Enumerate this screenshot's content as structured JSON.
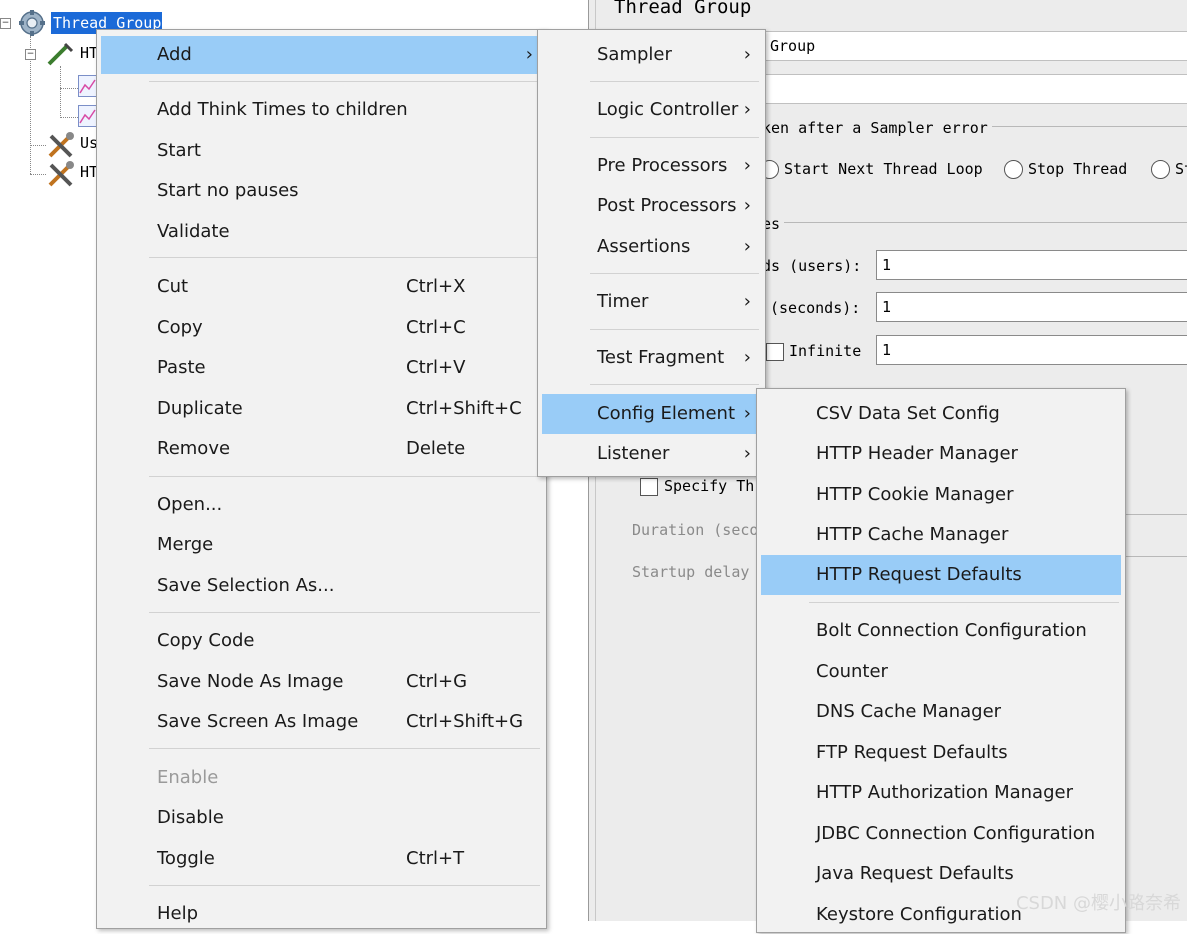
{
  "tree": {
    "selected": "Thread Group",
    "rows": [
      "HT",
      "Us",
      "HT"
    ]
  },
  "panel": {
    "title": "Thread Group",
    "name_value": "Group",
    "error_label": "ken after a Sampler error",
    "radio_next_loop": "Start Next Thread Loop",
    "radio_stop_thread": "Stop Thread",
    "radio_partial": "St",
    "props_partial": "es",
    "threads_label": "ds (users):",
    "threads_value": "1",
    "rampup_label": "(seconds):",
    "rampup_value": "1",
    "infinite_label": "Infinite",
    "loop_value": "1",
    "specify_label": "Specify Thr",
    "duration_label": "Duration (seco",
    "startup_label": "Startup delay"
  },
  "context_menu": {
    "add": "Add",
    "add_think_times": "Add Think Times to children",
    "start": "Start",
    "start_no_pauses": "Start no pauses",
    "validate": "Validate",
    "cut": "Cut",
    "cut_sc": "Ctrl+X",
    "copy": "Copy",
    "copy_sc": "Ctrl+C",
    "paste": "Paste",
    "paste_sc": "Ctrl+V",
    "duplicate": "Duplicate",
    "duplicate_sc": "Ctrl+Shift+C",
    "remove": "Remove",
    "remove_sc": "Delete",
    "open": "Open...",
    "merge": "Merge",
    "save_selection": "Save Selection As...",
    "copy_code": "Copy Code",
    "save_node_image": "Save Node As Image",
    "save_node_image_sc": "Ctrl+G",
    "save_screen_image": "Save Screen As Image",
    "save_screen_image_sc": "Ctrl+Shift+G",
    "enable": "Enable",
    "disable": "Disable",
    "toggle": "Toggle",
    "toggle_sc": "Ctrl+T",
    "help": "Help"
  },
  "add_menu": {
    "sampler": "Sampler",
    "logic_controller": "Logic Controller",
    "pre_processors": "Pre Processors",
    "post_processors": "Post Processors",
    "assertions": "Assertions",
    "timer": "Timer",
    "test_fragment": "Test Fragment",
    "config_element": "Config Element",
    "listener": "Listener"
  },
  "config_menu": {
    "csv_data_set": "CSV Data Set Config",
    "http_header_manager": "HTTP Header Manager",
    "http_cookie_manager": "HTTP Cookie Manager",
    "http_cache_manager": "HTTP Cache Manager",
    "http_request_defaults": "HTTP Request Defaults",
    "bolt_connection": "Bolt Connection Configuration",
    "counter": "Counter",
    "dns_cache_manager": "DNS Cache Manager",
    "ftp_request_defaults": "FTP Request Defaults",
    "http_auth_manager": "HTTP Authorization Manager",
    "jdbc_connection": "JDBC Connection Configuration",
    "java_request_defaults": "Java Request Defaults",
    "keystore_config": "Keystore Configuration"
  },
  "watermark": "CSDN @樱小路奈希",
  "colors": {
    "menu_bg": "#f2f2f2",
    "menu_highlight": "#99ccf7",
    "tree_selection": "#1b6ad8",
    "panel_bg": "#ececec"
  }
}
